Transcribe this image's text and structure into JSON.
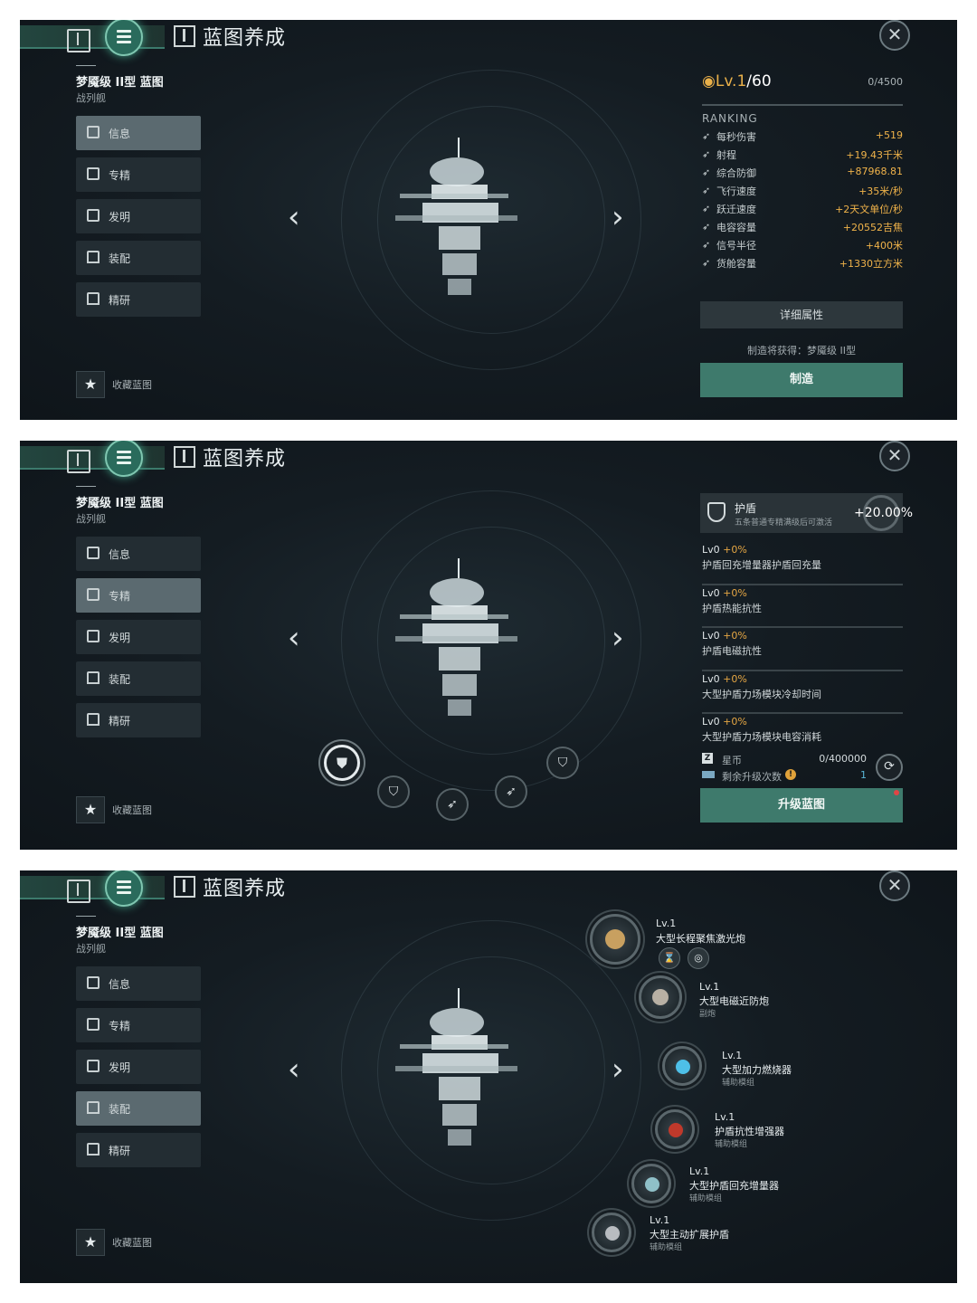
{
  "common": {
    "title": "蓝图养成",
    "ship_name": "梦魇级 II型 蓝图",
    "ship_class": "战列舰",
    "close_glyph": "✕",
    "nav": [
      {
        "label": "信息"
      },
      {
        "label": "专精"
      },
      {
        "label": "发明"
      },
      {
        "label": "装配"
      },
      {
        "label": "精研"
      }
    ],
    "favorite_label": "收藏蓝图",
    "arrow_left": "‹",
    "arrow_right": "›"
  },
  "panel_info": {
    "level": "Lv.1",
    "level_max": "/60",
    "xp": "0/4500",
    "ranking": "RANKING",
    "stats": [
      {
        "label": "每秒伤害",
        "value": "+519"
      },
      {
        "label": "射程",
        "value": "+19.43千米"
      },
      {
        "label": "综合防御",
        "value": "+87968.81"
      },
      {
        "label": "飞行速度",
        "value": "+35米/秒"
      },
      {
        "label": "跃迁速度",
        "value": "+2天文单位/秒"
      },
      {
        "label": "电容容量",
        "value": "+20552吉焦"
      },
      {
        "label": "信号半径",
        "value": "+400米"
      },
      {
        "label": "货舱容量",
        "value": "+1330立方米"
      }
    ],
    "detail_button": "详细属性",
    "craft_note": "制造将获得：梦魇级 II型",
    "craft_button": "制造"
  },
  "panel_spec": {
    "shield_name": "护盾",
    "shield_desc": "五条普通专精满级后可激活",
    "shield_pct": "+20.00%",
    "specs": [
      {
        "lv": "Lv0",
        "bonus": "+0%",
        "name": "护盾回充增量器护盾回充量"
      },
      {
        "lv": "Lv0",
        "bonus": "+0%",
        "name": "护盾热能抗性"
      },
      {
        "lv": "Lv0",
        "bonus": "+0%",
        "name": "护盾电磁抗性"
      },
      {
        "lv": "Lv0",
        "bonus": "+0%",
        "name": "大型护盾力场模块冷却时间"
      },
      {
        "lv": "Lv0",
        "bonus": "+0%",
        "name": "大型护盾力场模块电容消耗"
      }
    ],
    "coin_label": "星币",
    "coin_value": "0/400000",
    "remain_label": "剩余升级次数",
    "remain_value": "1",
    "upgrade_button": "升级蓝图"
  },
  "panel_equip": {
    "items": [
      {
        "lv": "Lv.1",
        "name": "大型长程聚焦激光炮",
        "type": "",
        "color": "#c8a060"
      },
      {
        "lv": "Lv.1",
        "name": "大型电磁近防炮",
        "type": "副炮",
        "color": "#b8b0a4"
      },
      {
        "lv": "Lv.1",
        "name": "大型加力燃烧器",
        "type": "辅助模组",
        "color": "#4ec0e8"
      },
      {
        "lv": "Lv.1",
        "name": "护盾抗性增强器",
        "type": "辅助模组",
        "color": "#c0392b"
      },
      {
        "lv": "Lv.1",
        "name": "大型护盾回充增量器",
        "type": "辅助模组",
        "color": "#8fc0c8"
      },
      {
        "lv": "Lv.1",
        "name": "大型主动扩展护盾",
        "type": "辅助模组",
        "color": "#b8bcc0"
      }
    ]
  },
  "colors": {
    "accent": "#3e7a6c",
    "gold": "#f0b34a",
    "panel_bg": "#141c22"
  }
}
